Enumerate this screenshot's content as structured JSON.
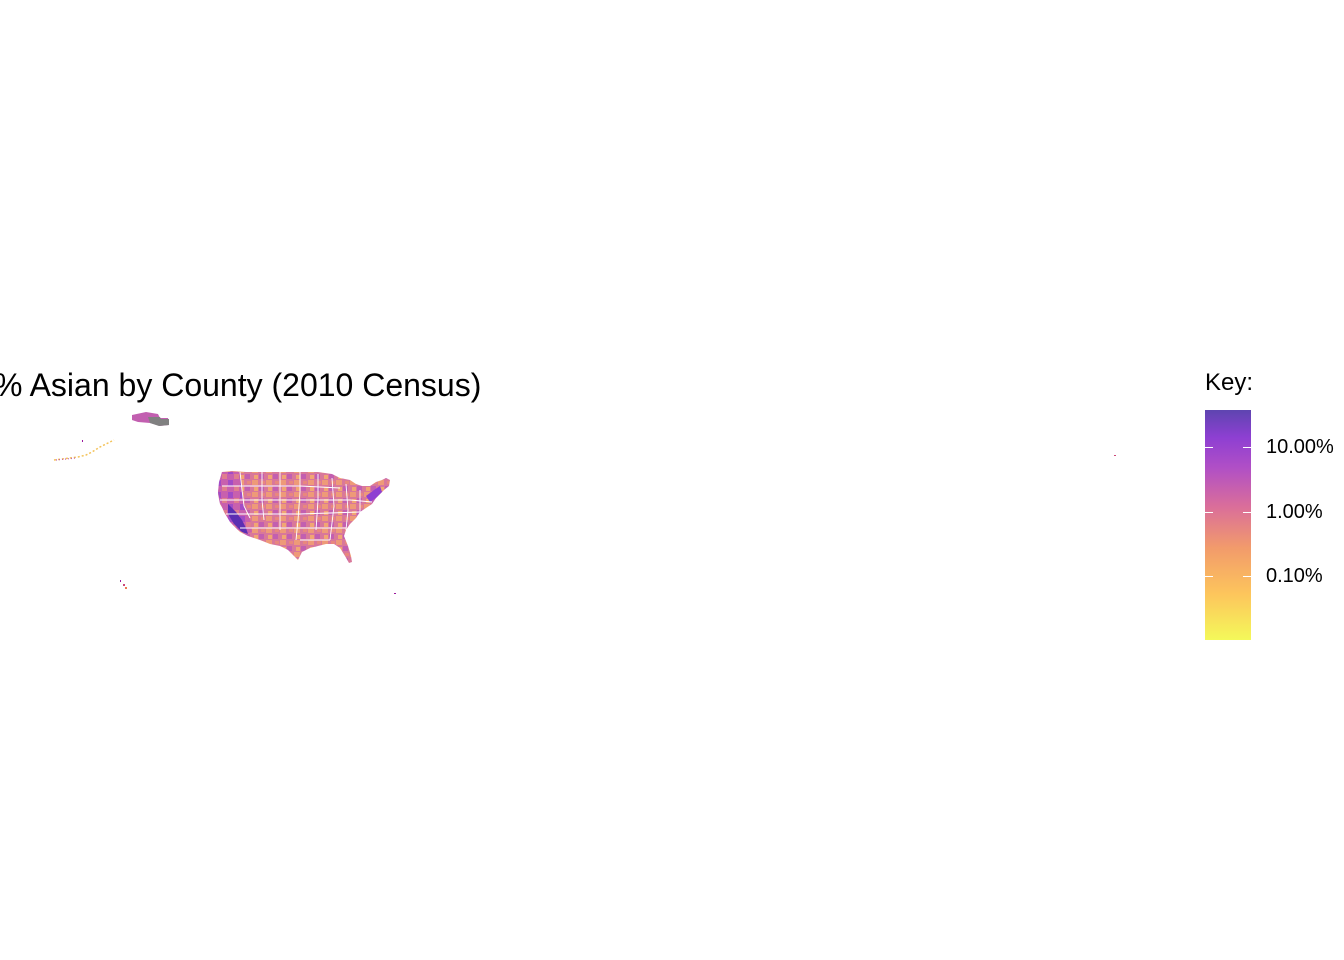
{
  "map": {
    "title": "% Asian by County (2010 Census)",
    "region": "United States counties",
    "missing_color": "#808080",
    "border_color": "#ffffff"
  },
  "legend": {
    "title": "Key:",
    "scale": "log10",
    "palette": [
      "#F0F921",
      "#FDB42F",
      "#ED7953",
      "#CC4778",
      "#9C179E",
      "#5C01A6"
    ],
    "stops": [
      {
        "color": "#F4F95A",
        "offset": 0
      },
      {
        "color": "#FDC55C",
        "offset": 0.2
      },
      {
        "color": "#F29B6B",
        "offset": 0.4
      },
      {
        "color": "#DA6E9A",
        "offset": 0.58
      },
      {
        "color": "#B04FC6",
        "offset": 0.75
      },
      {
        "color": "#8E3FD2",
        "offset": 0.88
      },
      {
        "color": "#5E45B0",
        "offset": 1
      }
    ],
    "ticks": [
      {
        "label": "10.00%",
        "value": 10.0
      },
      {
        "label": "1.00%",
        "value": 1.0
      },
      {
        "label": "0.10%",
        "value": 0.1
      }
    ]
  }
}
